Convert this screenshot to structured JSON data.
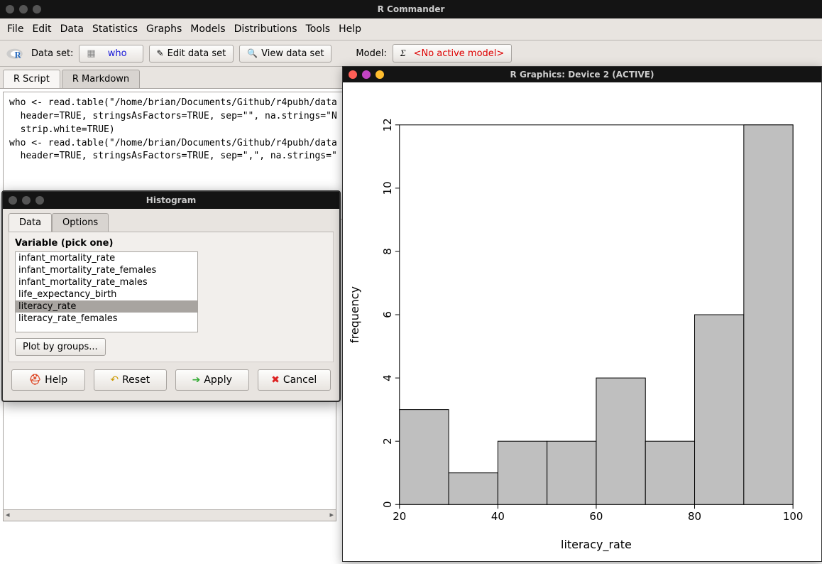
{
  "main_window": {
    "title": "R Commander",
    "menu": [
      "File",
      "Edit",
      "Data",
      "Statistics",
      "Graphs",
      "Models",
      "Distributions",
      "Tools",
      "Help"
    ],
    "toolbar": {
      "dataset_label": "Data set:",
      "dataset_value": "who",
      "edit_btn": "Edit data set",
      "view_btn": "View data set",
      "model_label": "Model:",
      "model_value": "<No active model>"
    },
    "tabs": {
      "script": "R Script",
      "markdown": "R Markdown"
    },
    "script": "who <- read.table(\"/home/brian/Documents/Github/r4pubh/data\n  header=TRUE, stringsAsFactors=TRUE, sep=\"\", na.strings=\"N\n  strip.white=TRUE)\nwho <- read.table(\"/home/brian/Documents/Github/r4pubh/data\n  header=TRUE, stringsAsFactors=TRUE, sep=\",\", na.strings=\""
  },
  "histogram_dialog": {
    "title": "Histogram",
    "tabs": {
      "data": "Data",
      "options": "Options"
    },
    "var_label": "Variable (pick one)",
    "variables": [
      "infant_mortality_rate",
      "infant_mortality_rate_females",
      "infant_mortality_rate_males",
      "life_expectancy_birth",
      "literacy_rate",
      "literacy_rate_females"
    ],
    "selected": "literacy_rate",
    "plot_by_groups": "Plot by groups...",
    "buttons": {
      "help": "Help",
      "reset": "Reset",
      "apply": "Apply",
      "cancel": "Cancel"
    }
  },
  "graphics_window": {
    "title": "R Graphics: Device 2 (ACTIVE)"
  },
  "chart_data": {
    "type": "bar",
    "xlabel": "literacy_rate",
    "ylabel": "frequency",
    "x_ticks": [
      20,
      40,
      60,
      80,
      100
    ],
    "y_ticks": [
      0,
      2,
      4,
      6,
      8,
      10,
      12
    ],
    "xlim": [
      20,
      100
    ],
    "ylim": [
      0,
      12
    ],
    "bin_edges": [
      20,
      30,
      40,
      50,
      60,
      70,
      80,
      90,
      100
    ],
    "values": [
      3,
      1,
      2,
      2,
      4,
      2,
      6,
      12
    ]
  }
}
